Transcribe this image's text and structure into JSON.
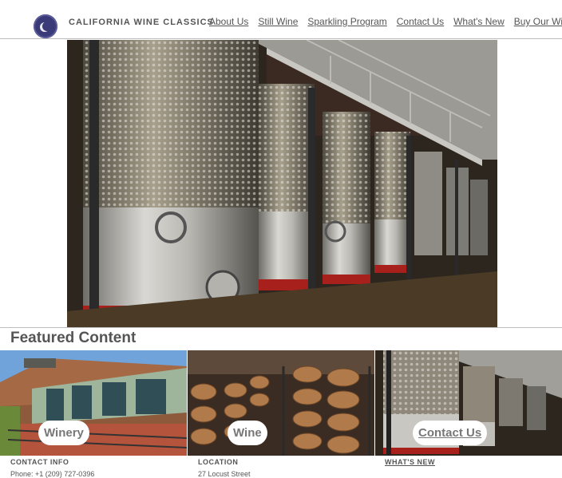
{
  "header": {
    "brand": "CALIFORNIA WINE CLASSICS",
    "nav": [
      {
        "label": "About Us"
      },
      {
        "label": "Still Wine"
      },
      {
        "label": "Sparkling Program"
      },
      {
        "label": "Contact Us"
      },
      {
        "label": "What's New"
      },
      {
        "label": "Buy Our Wine"
      }
    ]
  },
  "featured": {
    "heading": "Featured Content",
    "tiles": [
      {
        "label": "Winery"
      },
      {
        "label": "Wine"
      },
      {
        "label": "Contact Us"
      }
    ]
  },
  "footer": {
    "contact_heading": "CONTACT INFO",
    "phone": "Phone: +1 (209) 727-0396",
    "location_heading": "LOCATION",
    "address": "27 Locust Street",
    "whats_new_heading": "WHAT'S NEW"
  },
  "colors": {
    "logo": "#3b3a78",
    "text": "#555555",
    "rule": "#bdbdbd",
    "tank_red": "#a8201c"
  }
}
